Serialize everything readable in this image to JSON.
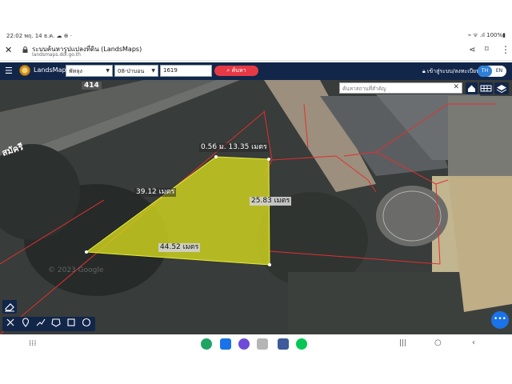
{
  "status_bar": {
    "time_date": "22:02  พฤ. 14 ธ.ค.  ☁ ⊕ ·",
    "right": "⌁ ᯤ .ıl 100%▮"
  },
  "browser": {
    "page_title": "ระบบค้นหารูปแปลงที่ดิน (LandsMaps)",
    "domain": "landsmaps.dol.go.th"
  },
  "header": {
    "brand": "LandsMaps",
    "province": "พัทลุง",
    "amphoe": "08-ป่าบอน",
    "deed_number": "1619",
    "search_label": "ค้นหา",
    "login_label": "เข้าสู่ระบบ/ลงทะเบียน",
    "lang_th": "TH",
    "lang_en": "EN"
  },
  "map": {
    "search_placeholder": "ค้นหาสถานที่สำคัญ",
    "road_number": "414",
    "road_name": "สมัครี",
    "watermark": "© 2023 Google",
    "parcel_fill_color": "#cfd41f",
    "boundary_color": "#e03030",
    "measurements": {
      "top": "0.56 ม. 13.35 เมตร",
      "left": "39.12 เมตร",
      "right": "25.83 เมตร",
      "bottom": "44.52 เมตร"
    }
  },
  "tools": [
    "measure-icon",
    "pin-icon",
    "line-icon",
    "polygon-icon",
    "rectangle-icon",
    "circle-icon"
  ]
}
